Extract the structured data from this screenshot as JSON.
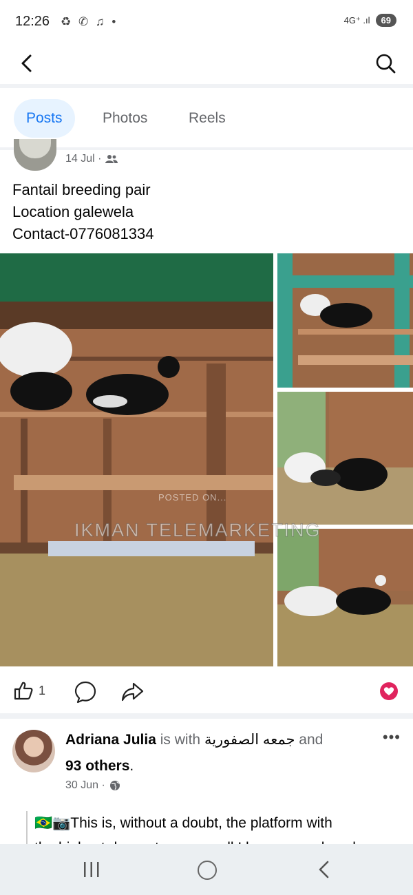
{
  "status_bar": {
    "time": "12:26",
    "notification_icons": "♻ ✆ ♫ •",
    "network": "4G⁺ .ıl",
    "battery": "69"
  },
  "app_bar": {
    "back_icon": "back-chevron-icon",
    "search_icon": "search-icon"
  },
  "tabs": [
    {
      "label": "Posts",
      "active": true
    },
    {
      "label": "Photos",
      "active": false
    },
    {
      "label": "Reels",
      "active": false
    }
  ],
  "post1": {
    "date": "14 Jul ·",
    "audience_icon": "friends-icon",
    "text_lines": [
      "Fantail breeding pair",
      "Location galewela",
      "Contact-0776081334"
    ],
    "watermark_small": "POSTED ON...",
    "watermark_large": "IKMAN TELEMARKETING",
    "like_count": "1",
    "reaction": "love-icon"
  },
  "post2": {
    "author": "Adriana Julia",
    "with_text": "is with",
    "tagged": "جمعه الصفورية",
    "and_text": "and",
    "others": "93 others",
    "date": "30 Jun ·",
    "privacy_icon": "globe-icon",
    "text_line1": "🇧🇷📷This is, without a doubt, the platform with",
    "text_line2": "the highest drop rate among all I have ever played"
  },
  "colors": {
    "accent": "#1877f2",
    "tab_active_bg": "#e7f3ff",
    "love": "#e0245e",
    "secondary_text": "#65676b"
  }
}
